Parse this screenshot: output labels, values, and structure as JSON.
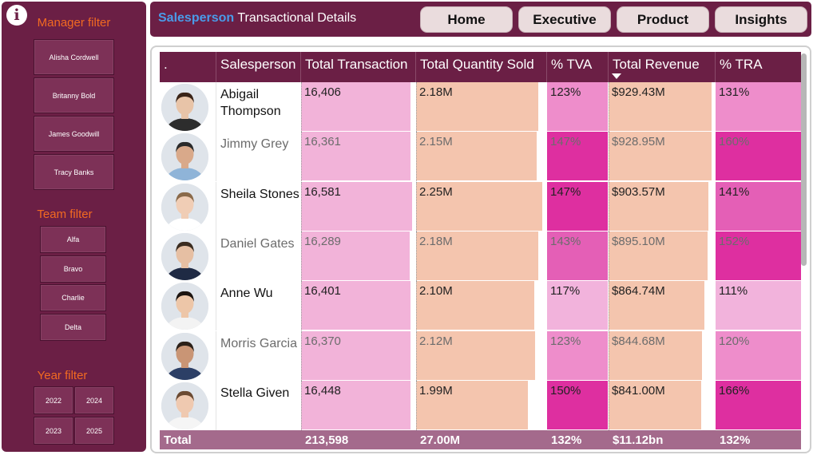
{
  "sidebar": {
    "info_icon": "info-icon",
    "manager_filter": {
      "title": "Manager filter",
      "options": [
        "Alisha Cordwell",
        "Britanny Bold",
        "James Goodwill",
        "Tracy Banks"
      ]
    },
    "team_filter": {
      "title": "Team filter",
      "options": [
        "Alfa",
        "Bravo",
        "Charlie",
        "Delta"
      ]
    },
    "year_filter": {
      "title": "Year filter",
      "options": [
        "2022",
        "2024",
        "2023",
        "2025"
      ]
    }
  },
  "header": {
    "title_highlight": "Salesperson",
    "title_rest": "Transactional Details",
    "nav": [
      "Home",
      "Executive",
      "Product",
      "Insights"
    ]
  },
  "table": {
    "columns": [
      ".",
      "Salesperson",
      "Total Transaction",
      "Total Quantity Sold",
      "% TVA",
      "Total Revenue",
      "% TRA"
    ],
    "sorted_by": "Total Revenue",
    "sort_direction": "descending",
    "rows": [
      {
        "name": "Abigail Thompson",
        "transaction": "16,406",
        "quantity": "2.18M",
        "tva": "123%",
        "revenue": "$929.43M",
        "tra": "131%"
      },
      {
        "name": "Jimmy Grey",
        "transaction": "16,361",
        "quantity": "2.15M",
        "tva": "147%",
        "revenue": "$928.95M",
        "tra": "160%"
      },
      {
        "name": "Sheila Stones",
        "transaction": "16,581",
        "quantity": "2.25M",
        "tva": "147%",
        "revenue": "$903.57M",
        "tra": "141%"
      },
      {
        "name": "Daniel Gates",
        "transaction": "16,289",
        "quantity": "2.18M",
        "tva": "143%",
        "revenue": "$895.10M",
        "tra": "152%"
      },
      {
        "name": "Anne Wu",
        "transaction": "16,401",
        "quantity": "2.10M",
        "tva": "117%",
        "revenue": "$864.74M",
        "tra": "111%"
      },
      {
        "name": "Morris Garcia",
        "transaction": "16,370",
        "quantity": "2.12M",
        "tva": "123%",
        "revenue": "$844.68M",
        "tra": "120%"
      },
      {
        "name": "Stella Given",
        "transaction": "16,448",
        "quantity": "1.99M",
        "tva": "150%",
        "revenue": "$841.00M",
        "tra": "166%"
      }
    ],
    "total": {
      "label": "Total",
      "transaction": "213,598",
      "quantity": "27.00M",
      "tva": "132%",
      "revenue": "$11.12bn",
      "tra": "132%"
    }
  },
  "colors": {
    "brand": "#6b1f45",
    "accent_orange": "#f26a21",
    "title_blue": "#4a9be8",
    "bar_transaction": "#f2b3d9",
    "bar_quantity_revenue": "#f4c5ae",
    "total_row": "#a46a8c"
  }
}
